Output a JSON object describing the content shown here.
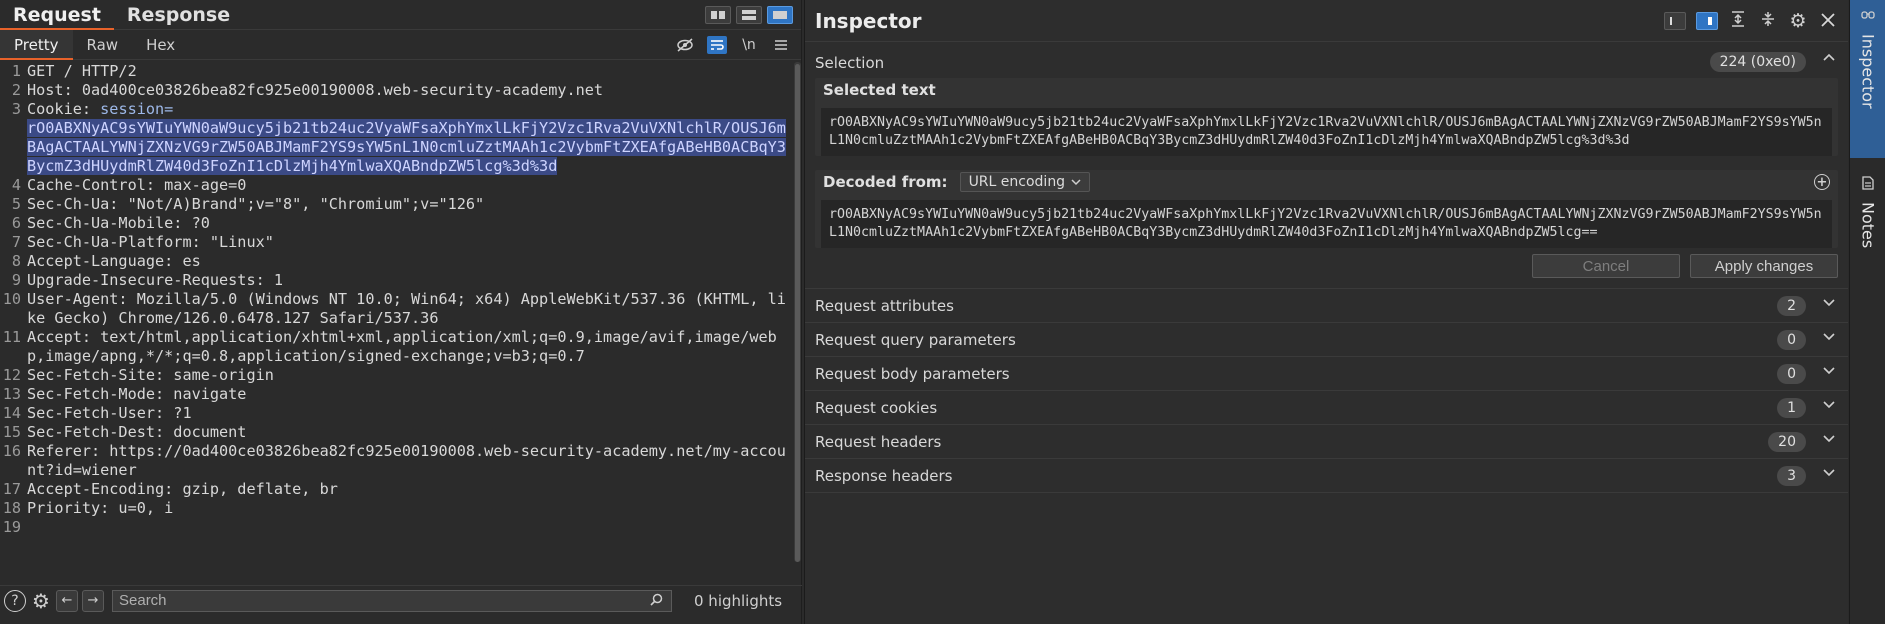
{
  "left": {
    "tabs": [
      "Request",
      "Response"
    ],
    "active_tab": "Request",
    "subtabs": [
      "Pretty",
      "Raw",
      "Hex"
    ],
    "active_subtab": "Pretty",
    "newline_toggle": "\\n",
    "lines": [
      {
        "n": "1",
        "text": "GET / HTTP/2"
      },
      {
        "n": "2",
        "text": "Host: 0ad400ce03826bea82fc925e00190008.web-security-academy.net"
      },
      {
        "n": "3",
        "key": "Cookie: ",
        "cookie_name": "session=",
        "selected": "rO0ABXNyAC9sYWIuYWN0aW9ucy5jb21tb24uc2VyaWFsaXphYmxlLkFjY2Vzc1Rva2VuVXNlchlR/OUSJ6mBAgACTAALYWNjZXNzVG9rZW50ABJMamF2YS9sYW5nL1N0cmluZztMAAh1c2VybmFtZXEAfgABeHB0ACBqY3BycmZ3dHUydmRlZW40d3FoZnI1cDlzMjh4YmlwaXQABndpZW5lcg%3d%3d"
      },
      {
        "n": "4",
        "text": "Cache-Control: max-age=0"
      },
      {
        "n": "5",
        "text": "Sec-Ch-Ua: \"Not/A)Brand\";v=\"8\", \"Chromium\";v=\"126\""
      },
      {
        "n": "6",
        "text": "Sec-Ch-Ua-Mobile: ?0"
      },
      {
        "n": "7",
        "text": "Sec-Ch-Ua-Platform: \"Linux\""
      },
      {
        "n": "8",
        "text": "Accept-Language: es"
      },
      {
        "n": "9",
        "text": "Upgrade-Insecure-Requests: 1"
      },
      {
        "n": "10",
        "text": "User-Agent: Mozilla/5.0 (Windows NT 10.0; Win64; x64) AppleWebKit/537.36 (KHTML, like Gecko) Chrome/126.0.6478.127 Safari/537.36"
      },
      {
        "n": "11",
        "text": "Accept: text/html,application/xhtml+xml,application/xml;q=0.9,image/avif,image/webp,image/apng,*/*;q=0.8,application/signed-exchange;v=b3;q=0.7"
      },
      {
        "n": "12",
        "text": "Sec-Fetch-Site: same-origin"
      },
      {
        "n": "13",
        "text": "Sec-Fetch-Mode: navigate"
      },
      {
        "n": "14",
        "text": "Sec-Fetch-User: ?1"
      },
      {
        "n": "15",
        "text": "Sec-Fetch-Dest: document"
      },
      {
        "n": "16",
        "text": "Referer: https://0ad400ce03826bea82fc925e00190008.web-security-academy.net/my-account?id=wiener"
      },
      {
        "n": "17",
        "text": "Accept-Encoding: gzip, deflate, br"
      },
      {
        "n": "18",
        "text": "Priority: u=0, i"
      },
      {
        "n": "19",
        "text": ""
      }
    ],
    "search_placeholder": "Search",
    "highlights": "0 highlights"
  },
  "inspector": {
    "title": "Inspector",
    "selection_label": "Selection",
    "selection_badge": "224 (0xe0)",
    "selected_text_label": "Selected text",
    "selected_text": "rO0ABXNyAC9sYWIuYWN0aW9ucy5jb21tb24uc2VyaWFsaXphYmxlLkFjY2Vzc1Rva2VuVXNlchlR/OUSJ6mBAgACTAALYWNjZXNzVG9rZW50ABJMamF2YS9sYW5nL1N0cmluZztMAAh1c2VybmFtZXEAfgABeHB0ACBqY3BycmZ3dHUydmRlZW40d3FoZnI1cDlzMjh4YmlwaXQABndpZW5lcg%3d%3d",
    "decoded_from_label": "Decoded from:",
    "decoded_from_value": "URL encoding",
    "decoded_text": "rO0ABXNyAC9sYWIuYWN0aW9ucy5jb21tb24uc2VyaWFsaXphYmxlLkFjY2Vzc1Rva2VuVXNlchlR/OUSJ6mBAgACTAALYWNjZXNzVG9rZW50ABJMamF2YS9sYW5nL1N0cmluZztMAAh1c2VybmFtZXEAfgABeHB0ACBqY3BycmZ3dHUydmRlZW40d3FoZnI1cDlzMjh4YmlwaXQABndpZW5lcg==",
    "cancel_label": "Cancel",
    "apply_label": "Apply changes",
    "sections": [
      {
        "label": "Request attributes",
        "count": "2"
      },
      {
        "label": "Request query parameters",
        "count": "0"
      },
      {
        "label": "Request body parameters",
        "count": "0"
      },
      {
        "label": "Request cookies",
        "count": "1"
      },
      {
        "label": "Request headers",
        "count": "20"
      },
      {
        "label": "Response headers",
        "count": "3"
      }
    ]
  },
  "rail": {
    "inspector": "Inspector",
    "notes": "Notes"
  },
  "colors": {
    "accent": "#e8622a",
    "selection_blue": "#2f75c4",
    "selection_highlight": "#3b4a86"
  }
}
